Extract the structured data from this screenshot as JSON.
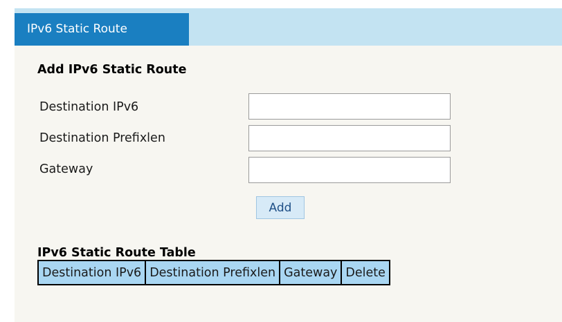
{
  "tab": {
    "label": "IPv6 Static Route"
  },
  "add_section": {
    "title": "Add IPv6 Static Route",
    "fields": [
      {
        "label": "Destination IPv6",
        "value": ""
      },
      {
        "label": "Destination Prefixlen",
        "value": ""
      },
      {
        "label": "Gateway",
        "value": ""
      }
    ],
    "add_button_label": "Add"
  },
  "table_section": {
    "title": "IPv6 Static Route Table",
    "columns": [
      "Destination IPv6",
      "Destination Prefixlen",
      "Gateway",
      "Delete"
    ],
    "rows": []
  },
  "colors": {
    "tab_active": "#1a7fc1",
    "tab_bar": "#c3e3f2",
    "panel_bg": "#f7f6f1",
    "table_header": "#a9d6f2",
    "button_bg": "#d7eaf7"
  }
}
